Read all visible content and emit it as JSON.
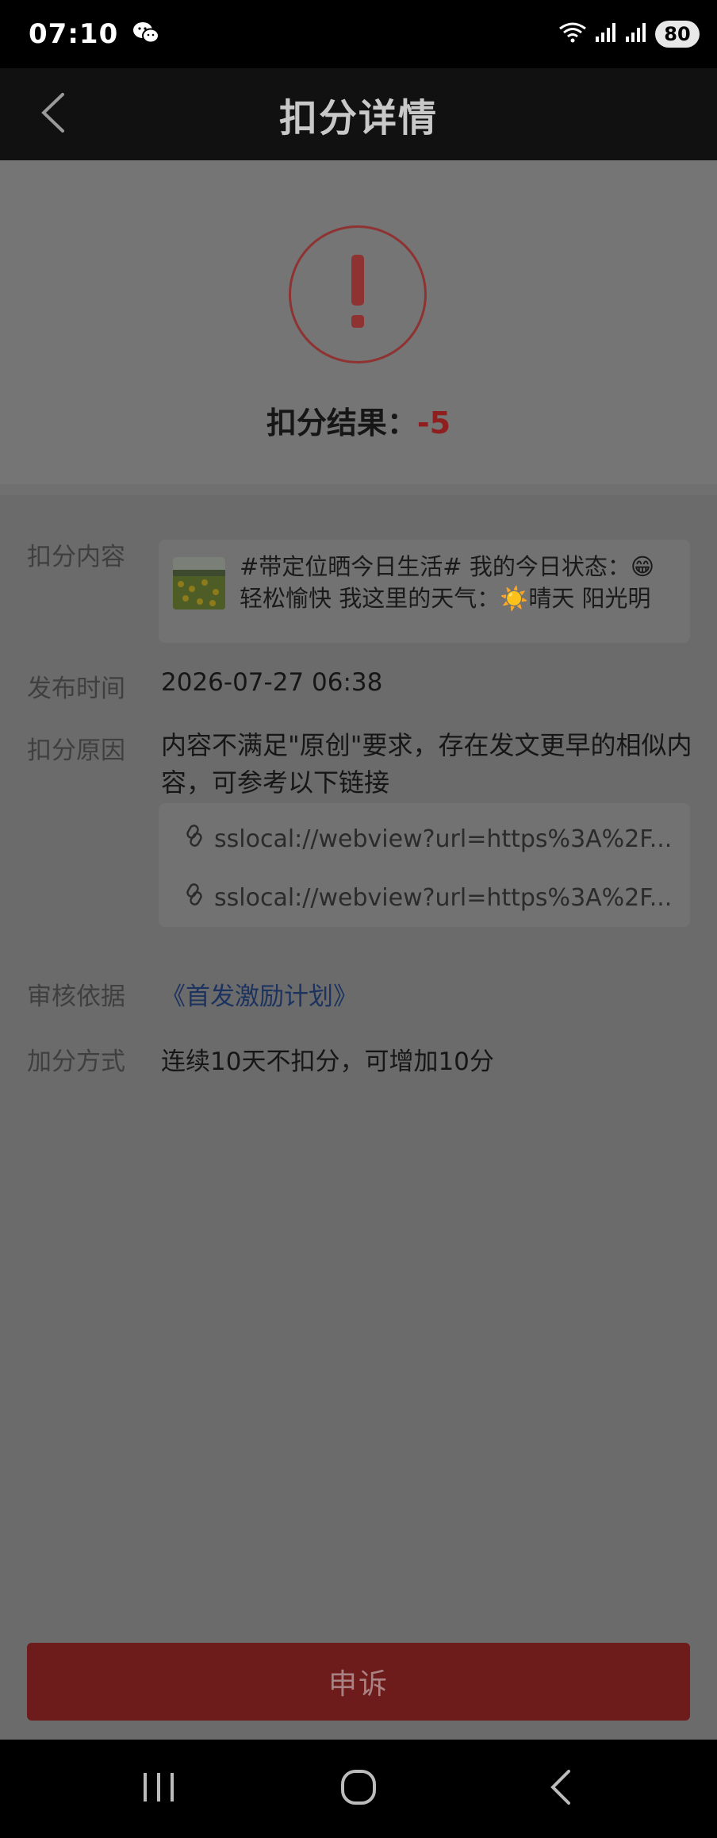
{
  "status_bar": {
    "time": "07:10",
    "battery": "80",
    "icons": [
      "wechat-icon",
      "wifi-icon",
      "signal-icon",
      "signal-icon"
    ]
  },
  "header": {
    "title": "扣分详情",
    "back_icon": "chevron-left-icon"
  },
  "result": {
    "icon": "warning-icon",
    "label": "扣分结果：",
    "value": "-5"
  },
  "details": {
    "content": {
      "label": "扣分内容",
      "text": "#带定位晒今日生活# 我的今日状态：😁轻松愉快 我这里的天气：☀️晴天 阳光明媚..."
    },
    "publish_time": {
      "label": "发布时间",
      "value": "2026-07-27 06:38"
    },
    "reason": {
      "label": "扣分原因",
      "value": "内容不满足\"原创\"要求，存在发文更早的相似内容，可参考以下链接",
      "links": [
        "sslocal://webview?url=https%3A%2F...",
        "sslocal://webview?url=https%3A%2F..."
      ]
    },
    "basis": {
      "label": "审核依据",
      "value": "《首发激励计划》"
    },
    "bonus": {
      "label": "加分方式",
      "value": "连续10天不扣分，可增加10分"
    }
  },
  "appeal_button": "申诉",
  "nav_bar": {
    "items": [
      "recent-apps-icon",
      "home-icon",
      "back-icon"
    ]
  },
  "colors": {
    "accent_red": "#8f1e1e",
    "link_blue": "#1c3360"
  }
}
